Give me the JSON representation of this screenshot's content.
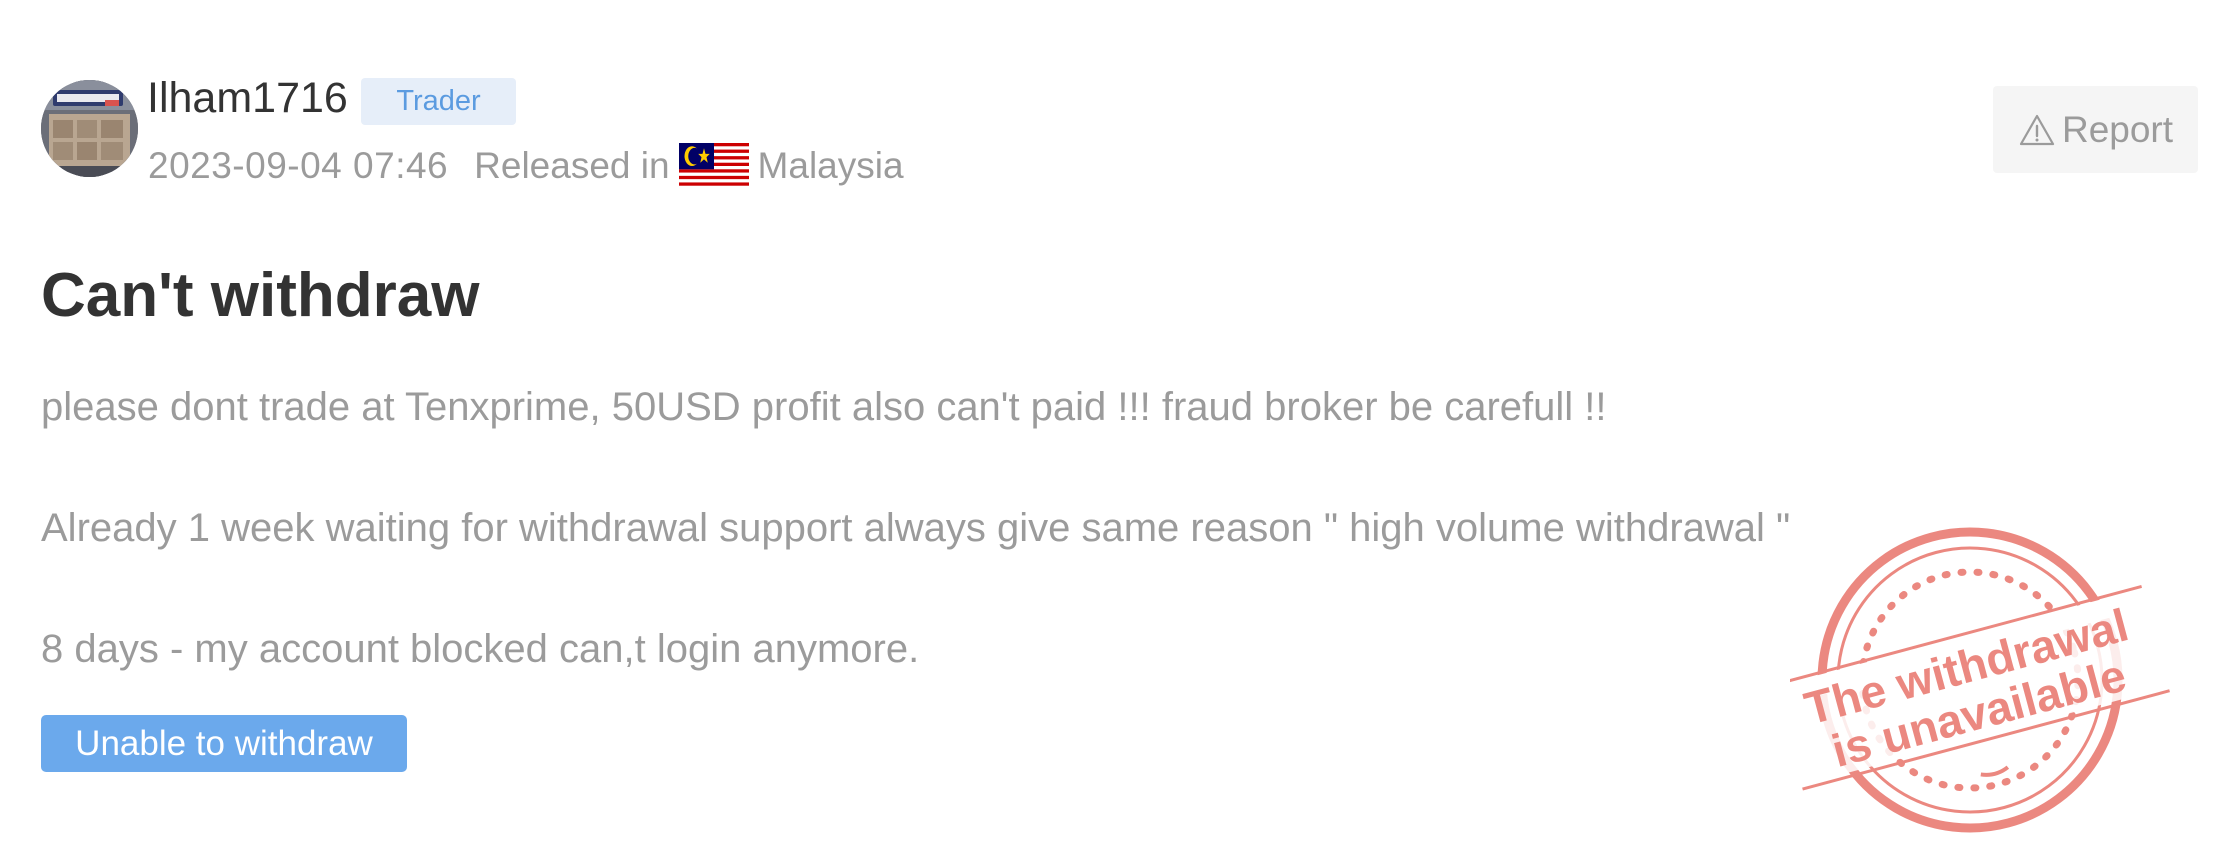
{
  "review": {
    "author": {
      "username": "Ilham1716",
      "role": "Trader",
      "avatar_icon": "storefront-photo-avatar"
    },
    "meta": {
      "date": "2023-09-04 07:46",
      "released_label": "Released in",
      "country": "Malaysia",
      "flag_icon": "malaysia-flag-icon"
    },
    "report": {
      "label": "Report",
      "icon": "warning-triangle-icon"
    },
    "title": "Can't withdraw",
    "paragraphs": [
      "please dont trade at Tenxprime, 50USD profit also can't paid !!! fraud broker be carefull !!",
      "Already 1 week waiting for withdrawal support always give same reason \" high volume withdrawal \"",
      "8 days - my account blocked can,t login anymore."
    ],
    "tag": "Unable to withdraw",
    "stamp": {
      "line1": "The withdrawal",
      "line2": "is unavailable",
      "color": "#e8746a"
    }
  },
  "colors": {
    "text_dark": "#333333",
    "text_muted": "#9b9b9b",
    "badge_bg": "#e6eef9",
    "badge_text": "#5b9be0",
    "tag_bg": "#6ba9ec",
    "report_bg": "#f5f5f5"
  }
}
